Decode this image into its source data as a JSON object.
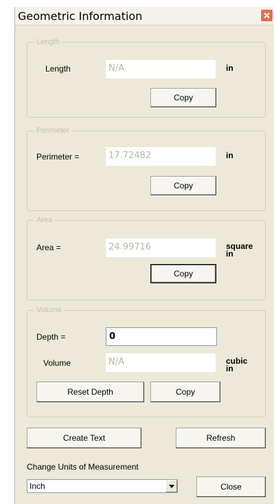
{
  "window": {
    "title": "Geometric Information"
  },
  "length": {
    "legend": "Length",
    "label": "Length",
    "value": "N/A",
    "unit": "in",
    "copy_label": "Copy"
  },
  "perimeter": {
    "legend": "Perimeter",
    "label": "Perimeter =",
    "value": "17.72482",
    "unit": "in",
    "copy_label": "Copy"
  },
  "area": {
    "legend": "Area",
    "label": "Area =",
    "value": "24.99716",
    "unit_line1": "square",
    "unit_line2": "in",
    "copy_label": "Copy"
  },
  "volume": {
    "legend": "Volume",
    "depth_label": "Depth =",
    "depth_value": "0",
    "volume_label": "Volume",
    "volume_value": "N/A",
    "unit_line1": "cubic",
    "unit_line2": "in",
    "reset_label": "Reset Depth",
    "copy_label": "Copy"
  },
  "actions": {
    "create_text_label": "Create Text",
    "refresh_label": "Refresh"
  },
  "units": {
    "label": "Change Units of Measurement",
    "selected": "Inch",
    "close_label": "Close"
  },
  "icons": {
    "close": "close-icon",
    "dropdown": "dropdown-arrow-icon"
  }
}
